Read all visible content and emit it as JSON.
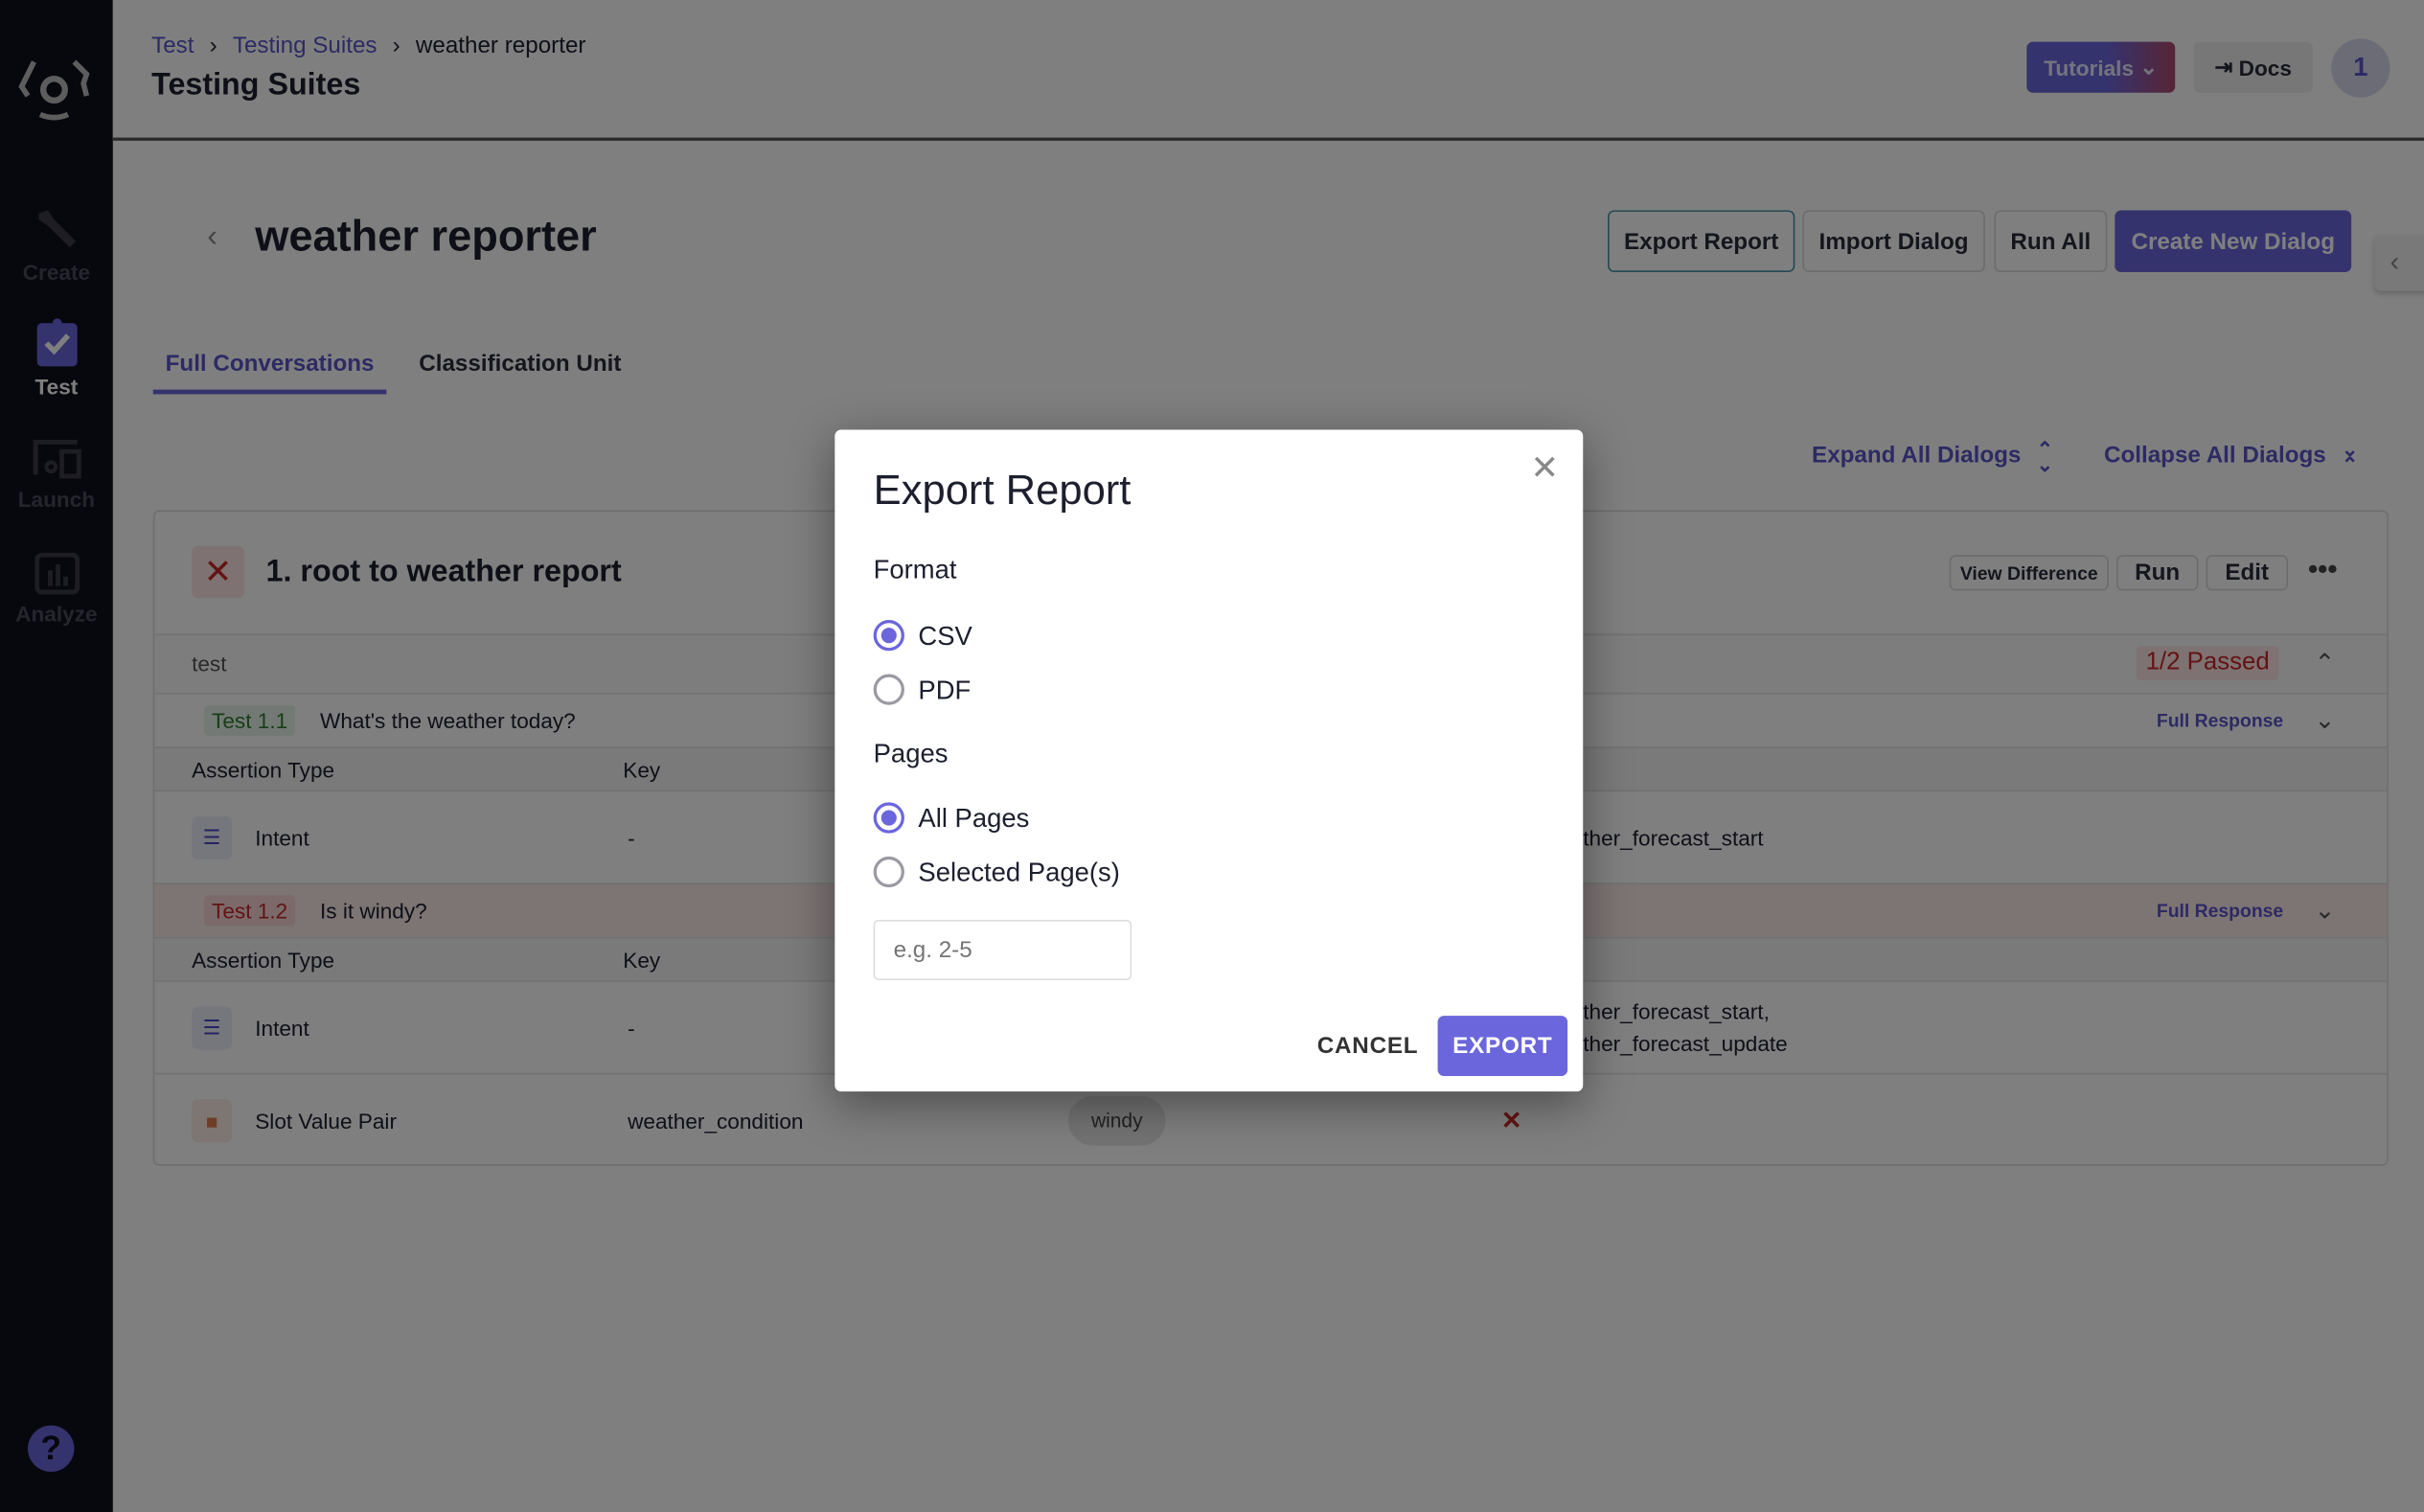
{
  "sidebar": {
    "items": [
      {
        "label": "Create",
        "icon": "wrench-icon"
      },
      {
        "label": "Test",
        "icon": "clipboard-check-icon",
        "active": true
      },
      {
        "label": "Launch",
        "icon": "devices-icon"
      },
      {
        "label": "Analyze",
        "icon": "bar-chart-icon"
      }
    ],
    "help_icon": "question-icon"
  },
  "header": {
    "breadcrumb": [
      "Test",
      "Testing Suites",
      "weather reporter"
    ],
    "title": "Testing Suites",
    "tutorials": "Tutorials",
    "docs": "Docs",
    "avatar": "1"
  },
  "page": {
    "title": "weather reporter",
    "buttons": {
      "export": "Export Report",
      "import": "Import Dialog",
      "run_all": "Run All",
      "create": "Create New Dialog"
    },
    "tabs": [
      {
        "label": "Full Conversations",
        "active": true
      },
      {
        "label": "Classification Unit"
      }
    ],
    "expand": "Expand All Dialogs",
    "collapse": "Collapse All Dialogs"
  },
  "dialog": {
    "number": "1.",
    "title": "root to weather report",
    "view_diff": "View Difference",
    "run": "Run",
    "edit": "Edit",
    "group": "test",
    "passed": "1/2 Passed",
    "tests": [
      {
        "id": "Test 1.1",
        "question": "What's the weather today?",
        "full_response": "Full Response",
        "status": "pass",
        "headers": [
          "Assertion Type",
          "Key"
        ],
        "rows": [
          {
            "type": "Intent",
            "key": "-",
            "value": "ther_forecast_start"
          }
        ]
      },
      {
        "id": "Test 1.2",
        "question": "Is it windy?",
        "full_response": "Full Response",
        "status": "fail",
        "headers": [
          "Assertion Type",
          "Key"
        ],
        "rows": [
          {
            "type": "Intent",
            "key": "-",
            "value": "ther_forecast_start,",
            "value2": "ther_forecast_update"
          },
          {
            "type": "Slot Value Pair",
            "key": "weather_condition",
            "chip": "windy",
            "result": "✕"
          }
        ]
      }
    ]
  },
  "modal": {
    "title": "Export Report",
    "format_label": "Format",
    "formats": [
      "CSV",
      "PDF"
    ],
    "format_selected": "CSV",
    "pages_label": "Pages",
    "pages": [
      "All Pages",
      "Selected Page(s)"
    ],
    "pages_selected": "All Pages",
    "pages_placeholder": "e.g. 2-5",
    "cancel": "CANCEL",
    "export": "EXPORT"
  },
  "colors": {
    "accent": "#6b66dc",
    "sidebar": "#0e0e1c",
    "fail": "#c62828",
    "pass": "#2e7d32"
  }
}
